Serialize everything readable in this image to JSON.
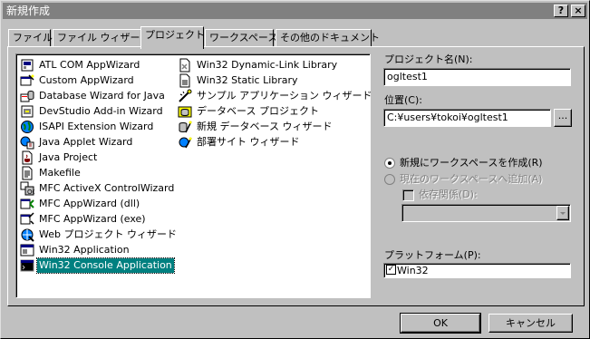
{
  "window": {
    "title": "新規作成",
    "help_button": "?",
    "close_button": "×"
  },
  "tabs": [
    {
      "label": "ファイル",
      "active": false
    },
    {
      "label": "ファイル ウィザード",
      "active": false
    },
    {
      "label": "プロジェクト",
      "active": true
    },
    {
      "label": "ワークスペース",
      "active": false
    },
    {
      "label": "その他のドキュメント",
      "active": false
    }
  ],
  "project_types_col1": [
    {
      "label": "ATL COM AppWizard",
      "icon": "atl-icon"
    },
    {
      "label": "Custom AppWizard",
      "icon": "wizard-icon"
    },
    {
      "label": "Database Wizard for Java",
      "icon": "database-icon"
    },
    {
      "label": "DevStudio Add-in Wizard",
      "icon": "addin-icon"
    },
    {
      "label": "ISAPI Extension Wizard",
      "icon": "globe-icon"
    },
    {
      "label": "Java Applet Wizard",
      "icon": "java-applet-icon"
    },
    {
      "label": "Java Project",
      "icon": "java-icon"
    },
    {
      "label": "Makefile",
      "icon": "makefile-icon"
    },
    {
      "label": "MFC ActiveX ControlWizard",
      "icon": "activex-icon"
    },
    {
      "label": "MFC AppWizard (dll)",
      "icon": "mfc-dll-icon"
    },
    {
      "label": "MFC AppWizard (exe)",
      "icon": "mfc-exe-icon"
    },
    {
      "label": "Web プロジェクト ウィザード",
      "icon": "web-icon"
    },
    {
      "label": "Win32 Application",
      "icon": "win32-app-icon"
    },
    {
      "label": "Win32 Console Application",
      "icon": "console-icon",
      "selected": true
    }
  ],
  "project_types_col2": [
    {
      "label": "Win32 Dynamic-Link Library",
      "icon": "dll-icon"
    },
    {
      "label": "Win32 Static Library",
      "icon": "lib-icon"
    },
    {
      "label": "サンプル アプリケーション ウィザード",
      "icon": "sample-wizard-icon"
    },
    {
      "label": "データベース プロジェクト",
      "icon": "db-project-icon"
    },
    {
      "label": "新規 データベース ウィザード",
      "icon": "new-db-wizard-icon"
    },
    {
      "label": "部署サイト ウィザード",
      "icon": "dept-site-icon"
    }
  ],
  "form": {
    "project_name_label": "プロジェクト名(N):",
    "project_name_value": "ogltest1",
    "location_label": "位置(C):",
    "location_value": "C:¥users¥tokoi¥ogltest1",
    "browse_button": "...",
    "radio_new_workspace": "新規にワークスペースを作成(R)",
    "radio_add_workspace": "現在のワークスペースへ追加(A)",
    "dependency_label": "依存関係(D):",
    "platform_label": "プラットフォーム(P):",
    "platform_item": "Win32",
    "platform_checked": "✓"
  },
  "buttons": {
    "ok": "OK",
    "cancel": "キャンセル"
  },
  "colors": {
    "face": "#c0c0c0",
    "selection": "#008080",
    "titlebar_inactive": "#808080"
  }
}
